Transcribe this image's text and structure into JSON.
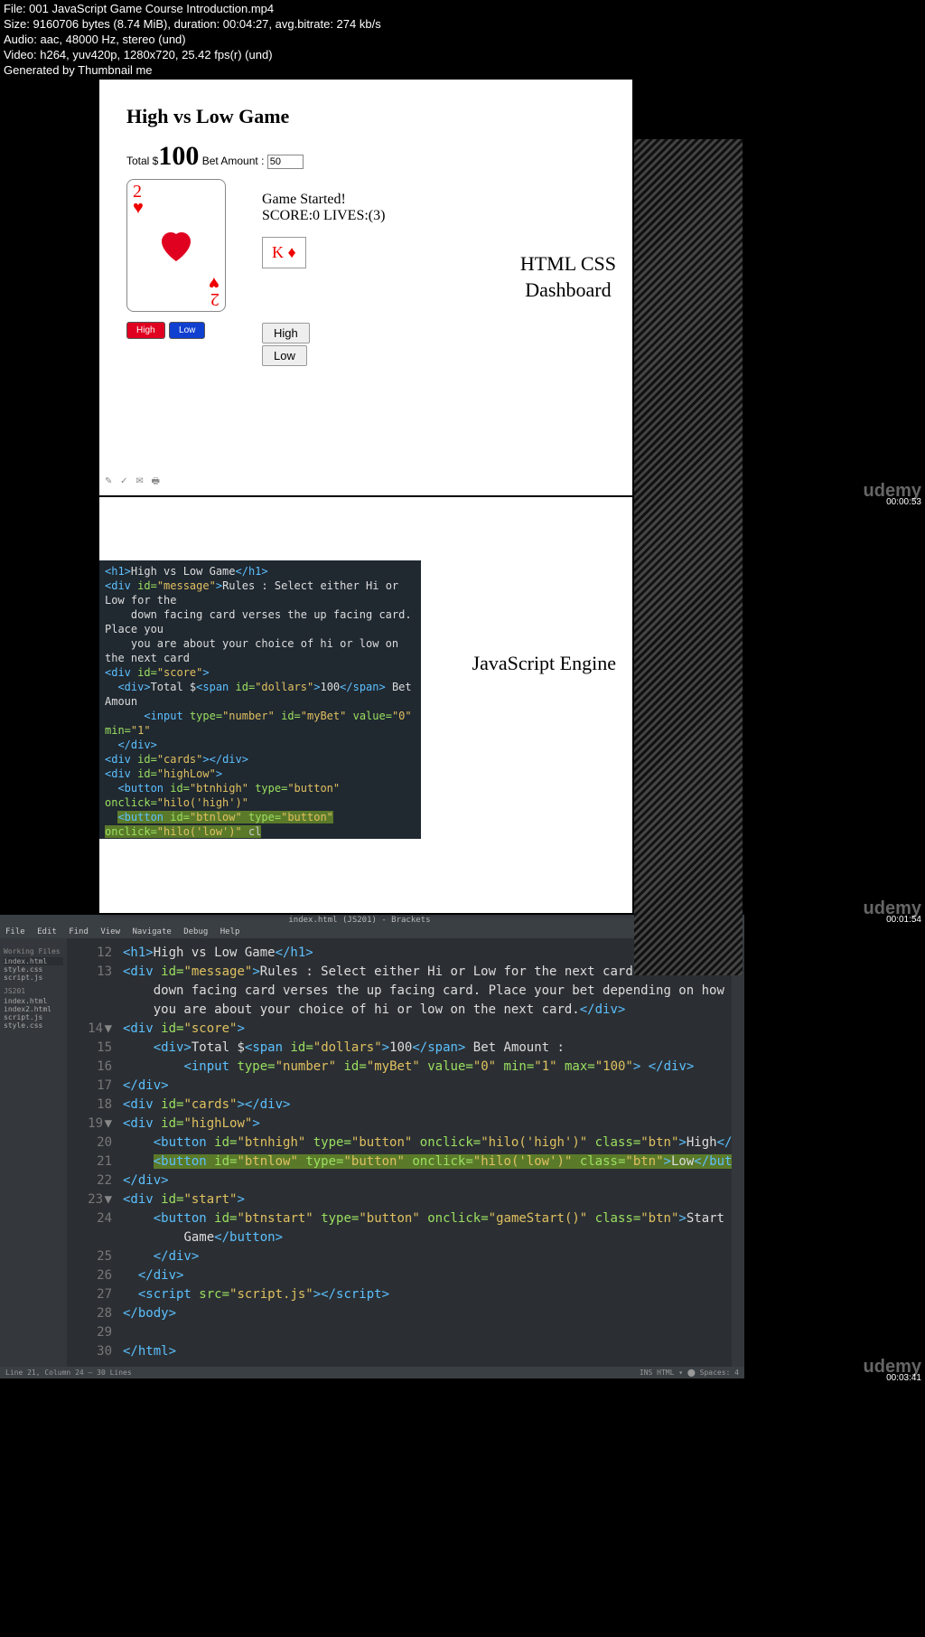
{
  "meta": {
    "file": "File: 001 JavaScript Game Course Introduction.mp4",
    "size": "Size: 9160706 bytes (8.74 MiB), duration: 00:04:27, avg.bitrate: 274 kb/s",
    "audio": "Audio: aac, 48000 Hz, stereo (und)",
    "video": "Video: h264, yuv420p, 1280x720, 25.42 fps(r) (und)",
    "gen": "Generated by Thumbnail me"
  },
  "watermark": "udemy",
  "ts1": "00:00:53",
  "ts2": "00:01:54",
  "ts3": "00:03:41",
  "slide1": {
    "title": "High vs Low Game",
    "total_label": "Total $",
    "total_value": "100",
    "bet_label": " Bet Amount : ",
    "bet_value": "50",
    "card_rank": "2",
    "game_started": "Game Started!",
    "score_line": "SCORE:0 LIVES:(3)",
    "mini_card": "K ♦",
    "btn_high": "High",
    "btn_low": "Low",
    "plain_high": "High",
    "plain_low": "Low",
    "right_label": "HTML CSS\nDashboard"
  },
  "slide2": {
    "right_label": "JavaScript\nEngine"
  },
  "brackets": {
    "title": "index.html (JS201) - Brackets",
    "menu": [
      "File",
      "Edit",
      "Find",
      "View",
      "Navigate",
      "Debug",
      "Help"
    ],
    "working_hdr": "Working Files",
    "files_top": [
      "index.html",
      "style.css",
      "script.js"
    ],
    "proj": "JS201",
    "files_bot": [
      "index.html",
      "index2.html",
      "script.js",
      "style.css"
    ],
    "status_left": "Line 21, Column 24 — 30 Lines",
    "status_right": "INS   HTML ▾   ⬤  Spaces: 4"
  },
  "code": {
    "l12": "        <h1>High vs Low Game</h1>",
    "l13a": "        <div id=\"message\">Rules : Select either Hi or Low for the next card. Guess the value of the",
    "l13b": "            down facing card verses the up facing card. Place your bet depending on how confident",
    "l13c": "            you are about your choice of hi or low on the next card.</div>",
    "l14": "        <div id=\"score\">",
    "l15": "            <div>Total $<span id=\"dollars\">100</span> Bet Amount :",
    "l16": "                <input type=\"number\" id=\"myBet\" value=\"0\" min=\"1\" max=\"100\"> </div>",
    "l17": "        </div>",
    "l18": "        <div id=\"cards\"></div>",
    "l19": "        <div id=\"highLow\">",
    "l20": "            <button id=\"btnhigh\" type=\"button\" onclick=\"hilo('high')\" class=\"btn\">High</button>",
    "l21": "            <button id=\"btnlow\" type=\"button\" onclick=\"hilo('low')\" class=\"btn\">Low</button>",
    "l22": "        </div>",
    "l23": "        <div id=\"start\">",
    "l24a": "            <button id=\"btnstart\" type=\"button\" onclick=\"gameStart()\" class=\"btn\">Start",
    "l24b": "                Game</button>",
    "l25": "        </div>",
    "l26": "    </div>",
    "l27": "    <script src=\"script.js\"></script>",
    "l28": "</body>",
    "l29": "",
    "l30": "</html>"
  }
}
